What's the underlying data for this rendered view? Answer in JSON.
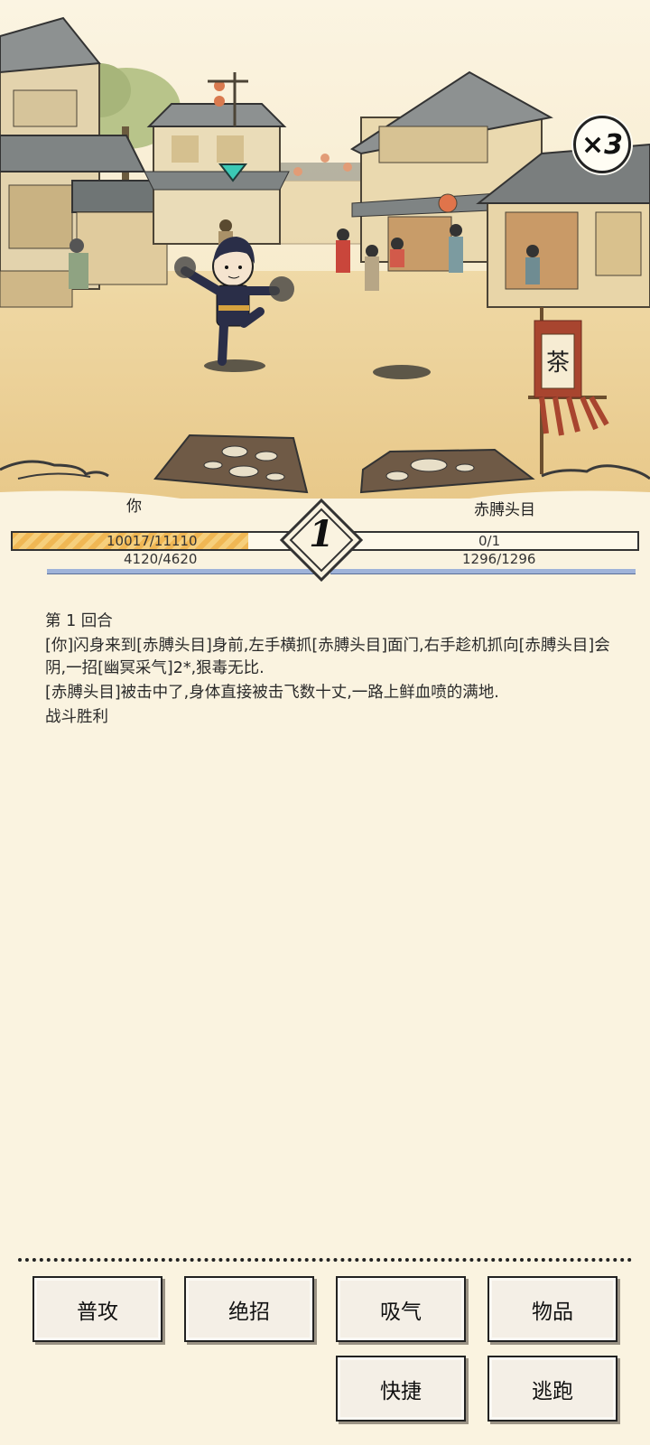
{
  "speed": {
    "label": "×3"
  },
  "player": {
    "name": "你",
    "hp_text": "10017/11110",
    "hp_current": 10017,
    "hp_max": 11110,
    "mp_text": "4120/4620",
    "mp_current": 4120,
    "mp_max": 4620
  },
  "enemy": {
    "name": "赤膊头目",
    "hp_text": "0/1",
    "hp_current": 0,
    "hp_max": 1,
    "mp_text": "1296/1296",
    "mp_current": 1296,
    "mp_max": 1296
  },
  "round": {
    "number": "1"
  },
  "scene": {
    "flag_text": "茶"
  },
  "log": {
    "line1": "第 1 回合",
    "line2": "[你]闪身来到[赤膊头目]身前,左手横抓[赤膊头目]面门,右手趁机抓向[赤膊头目]会阴,一招[幽冥采气]2*,狠毒无比.",
    "line3": "[赤膊头目]被击中了,身体直接被击飞数十丈,一路上鲜血喷的满地.",
    "line4": "战斗胜利"
  },
  "actions": {
    "attack": "普攻",
    "skill": "绝招",
    "qi": "吸气",
    "items": "物品",
    "quick": "快捷",
    "flee": "逃跑"
  }
}
